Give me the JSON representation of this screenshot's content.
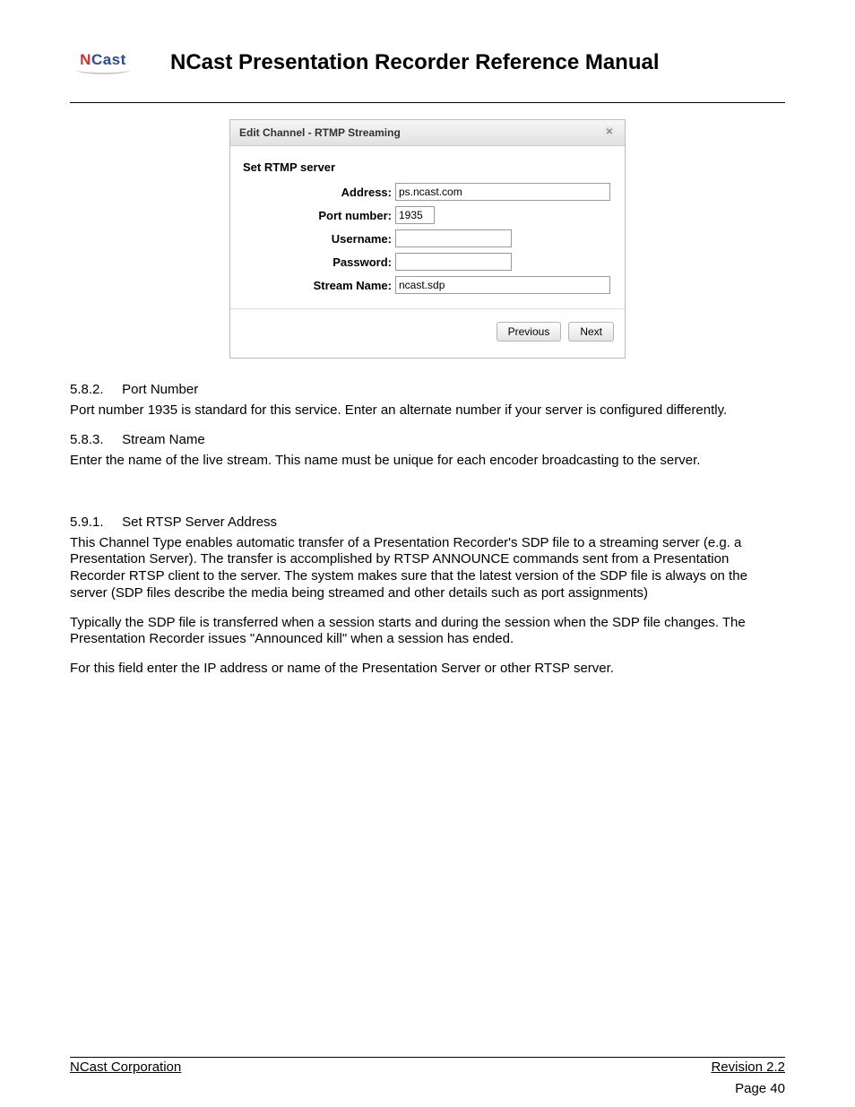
{
  "header": {
    "logo_main_1": "N",
    "logo_main_2": "Cast",
    "title": "NCast Presentation Recorder Reference Manual"
  },
  "dialog": {
    "title": "Edit Channel - RTMP Streaming",
    "section_title": "Set RTMP server",
    "labels": {
      "address": "Address:",
      "port": "Port number:",
      "username": "Username:",
      "password": "Password:",
      "stream": "Stream Name:"
    },
    "values": {
      "address": "ps.ncast.com",
      "port": "1935",
      "username": "",
      "password": "",
      "stream": "ncast.sdp"
    },
    "buttons": {
      "previous": "Previous",
      "next": "Next"
    }
  },
  "sections": {
    "s582_num": "5.8.2.",
    "s582_title": "Port Number",
    "s582_body": "Port number 1935 is standard for this service. Enter an alternate number if your server is configured differently.",
    "s583_num": "5.8.3.",
    "s583_title": "Stream Name",
    "s583_body": "Enter the name of the live stream. This name must be unique for each encoder broadcasting to the server.",
    "s591_num": "5.9.1.",
    "s591_title": "Set RTSP Server Address",
    "s591_p1": "This Channel Type enables automatic transfer of a Presentation Recorder's SDP file to a streaming server (e.g. a Presentation Server). The transfer is accomplished by RTSP ANNOUNCE commands sent from a Presentation Recorder RTSP client to the server. The system makes sure that the latest version of the SDP file is always on the server (SDP files describe the media being streamed and other details such as port assignments)",
    "s591_p2": "Typically the SDP file is transferred when a session starts and during the session when the SDP file changes. The Presentation Recorder issues \"Announced kill\" when a session has ended.",
    "s591_p3": "For this field enter the IP address or name of the Presentation Server or other RTSP server."
  },
  "footer": {
    "left": "NCast Corporation",
    "right": "Revision 2.2",
    "page": "Page 40"
  }
}
